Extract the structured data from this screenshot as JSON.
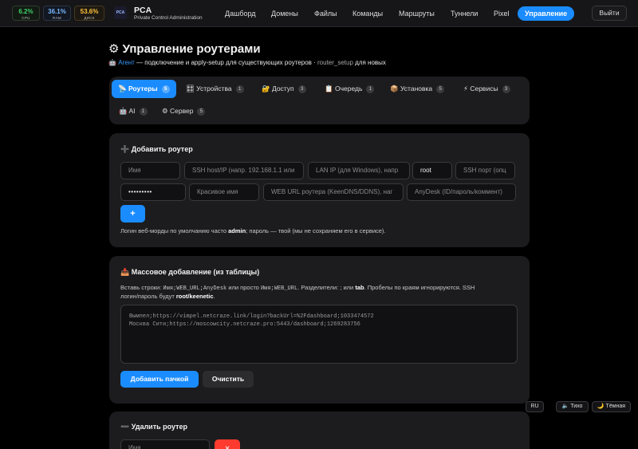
{
  "stats": [
    {
      "value": "6.2%",
      "label": "CPU",
      "color": "#3fd068"
    },
    {
      "value": "36.1%",
      "label": "RAM",
      "color": "#79b8ff"
    },
    {
      "value": "53.6%",
      "label": "ДИСК",
      "color": "#ffc23d"
    }
  ],
  "brand": {
    "logo": "PCA",
    "title": "PCA",
    "subtitle": "Private Control Administration"
  },
  "nav": [
    "Дашборд",
    "Домены",
    "Файлы",
    "Команды",
    "Маршруты",
    "Туннели",
    "Pixel",
    "Управление"
  ],
  "logout": "Выйти",
  "page": {
    "title": "⚙ Управление роутерами",
    "sub_icon": "🤖",
    "sub_link": "Агент",
    "sub_text": " — подключение и apply-setup для существующих роутеров · ",
    "sub_code": "router_setup",
    "sub_end": " для новых"
  },
  "tabs": [
    {
      "icon": "📡",
      "label": "Роутеры",
      "count": "5"
    },
    {
      "icon": "🎛",
      "label": "Устройства",
      "count": "1"
    },
    {
      "icon": "🔐",
      "label": "Доступ",
      "count": "3"
    },
    {
      "icon": "📋",
      "label": "Очередь",
      "count": "1"
    },
    {
      "icon": "📦",
      "label": "Установка",
      "count": "5"
    },
    {
      "icon": "⚡",
      "label": "Сервисы",
      "count": "3"
    },
    {
      "icon": "🤖",
      "label": "AI",
      "count": "1"
    },
    {
      "icon": "⚙",
      "label": "Сервер",
      "count": "5"
    }
  ],
  "add": {
    "title": "➕ Добавить роутер",
    "name_ph": "Имя",
    "ssh_ph": "SSH host/IP (напр. 192.168.1.1 или",
    "lan_ph": "LAN IP (для Windows), напр",
    "user_val": "root",
    "port_ph": "SSH порт (опц",
    "pass_val": "•••••••••",
    "pretty_ph": "Красивое имя",
    "web_ph": "WEB URL роутера (KeenDNS/DDNS), наг",
    "anydesk_ph": "AnyDesk (ID/пароль/коммент)",
    "button": "+",
    "hint_a": "Логин веб-морды по умолчанию часто ",
    "hint_b": "admin",
    "hint_c": "; пароль — твой (мы не сохраняем его в сервисе)."
  },
  "bulk": {
    "title": "📥 Массовое добавление (из таблицы)",
    "hint_a": "Вставь строки: ",
    "hint_code1": "Имя;WEB_URL;AnyDesk",
    "hint_b": " или просто ",
    "hint_code2": "Имя;WEB_URL",
    "hint_c": ". Разделители: ",
    "hint_d": "; или ",
    "hint_tab": "tab",
    "hint_e": ". Пробелы по краям игнорируются. SSH",
    "hint_f": "логин/пароль будут ",
    "hint_g": "root/keenetic",
    "hint_h": ".",
    "lines": "Вымпел;https://vimpel.netcraze.link/login?backUrl=%2Fdashboard;1033474572\nМосква Сити;https://moscowcity.netcraze.pro:5443/dashboard;1269283756",
    "add_button": "Добавить пачкой",
    "clear_button": "Очистить"
  },
  "delete": {
    "title": "➖ Удалить роутер",
    "name_ph": "Имя",
    "button": "✕"
  },
  "floaters": {
    "lang": "RU",
    "quiet": "🔈 Тихо",
    "theme": "🌙 Тёмная"
  }
}
